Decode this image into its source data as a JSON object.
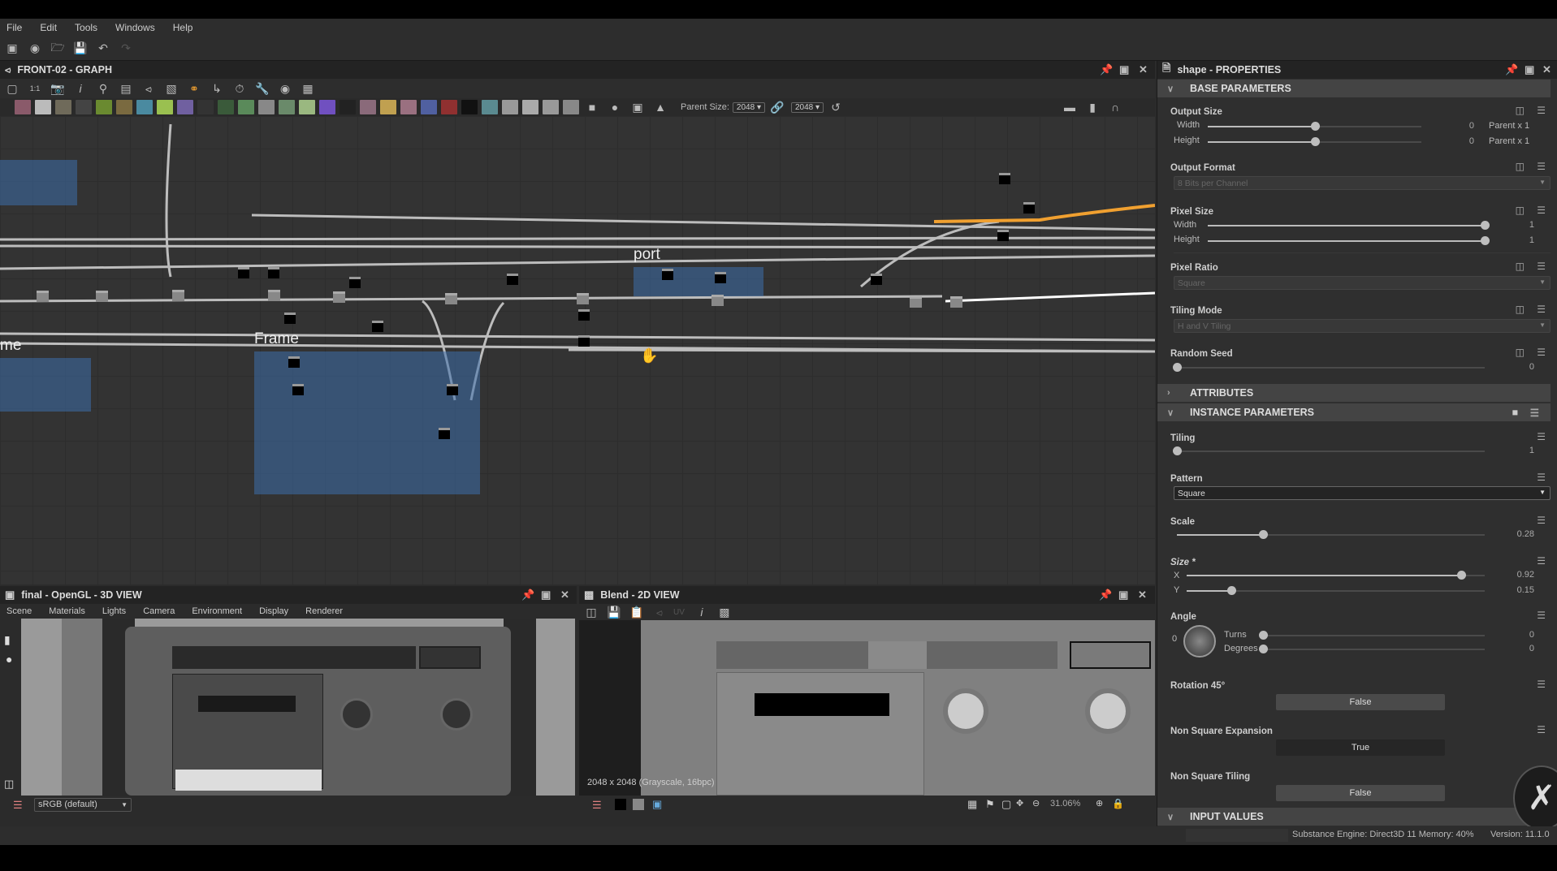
{
  "menu": [
    "File",
    "Edit",
    "Tools",
    "Windows",
    "Help"
  ],
  "main_toolbar": {
    "icons": [
      "new-package-icon",
      "new-graph-icon",
      "open-icon",
      "save-icon",
      "undo-icon",
      "redo-icon"
    ]
  },
  "graph": {
    "title": "FRONT-02 - GRAPH",
    "toolbar_icons": [
      "frame-all-icon",
      "zoom-1-1-icon",
      "screenshot-icon",
      "info-icon",
      "search-icon",
      "align-icon",
      "graph-icon",
      "stack-icon",
      "link-icon",
      "connect-icon",
      "timer-icon",
      "tools-icon",
      "preview-icon",
      "grid-snap-icon"
    ],
    "parent_size_label": "Parent Size:",
    "parent_size_w": "2048",
    "parent_size_h": "2048",
    "frames": [
      {
        "title": "port"
      },
      {
        "title": "Frame"
      },
      {
        "title": "me"
      }
    ]
  },
  "properties": {
    "title": "shape - PROPERTIES",
    "sections": {
      "base": "BASE PARAMETERS",
      "attributes": "ATTRIBUTES",
      "instance": "INSTANCE PARAMETERS",
      "input": "INPUT VALUES"
    },
    "output_size": {
      "label": "Output Size",
      "width_label": "Width",
      "height_label": "Height",
      "width_value": "0",
      "height_value": "0",
      "width_suffix": "Parent x 1",
      "height_suffix": "Parent x 1",
      "width_fraction": 0.5,
      "height_fraction": 0.5
    },
    "output_format": {
      "label": "Output Format",
      "value": "8 Bits per Channel"
    },
    "pixel_size": {
      "label": "Pixel Size",
      "width_label": "Width",
      "height_label": "Height",
      "width_value": "1",
      "height_value": "1",
      "width_fraction": 1.0,
      "height_fraction": 1.0
    },
    "pixel_ratio": {
      "label": "Pixel Ratio",
      "value": "Square"
    },
    "tiling_mode": {
      "label": "Tiling Mode",
      "value": "H and V Tiling"
    },
    "random_seed": {
      "label": "Random Seed",
      "value": "0",
      "fraction": 0.0
    },
    "tiling": {
      "label": "Tiling",
      "value": "1",
      "fraction": 0.0
    },
    "pattern": {
      "label": "Pattern",
      "value": "Square"
    },
    "scale": {
      "label": "Scale",
      "value": "0.28",
      "fraction": 0.28
    },
    "size": {
      "label": "Size *",
      "x_label": "X",
      "y_label": "Y",
      "x_value": "0.92",
      "y_value": "0.15",
      "x_fraction": 0.92,
      "y_fraction": 0.15
    },
    "angle": {
      "label": "Angle",
      "dial_value": "0",
      "turns_label": "Turns",
      "degrees_label": "Degrees",
      "turns_value": "0",
      "degrees_value": "0"
    },
    "rotation45": {
      "label": "Rotation 45°",
      "value": "False"
    },
    "non_square_expansion": {
      "label": "Non Square Expansion",
      "value": "True"
    },
    "non_square_tiling": {
      "label": "Non Square Tiling",
      "value": "False"
    }
  },
  "view3d": {
    "title": "final - OpenGL - 3D VIEW",
    "menu": [
      "Scene",
      "Materials",
      "Lights",
      "Camera",
      "Environment",
      "Display",
      "Renderer"
    ],
    "colorspace": "sRGB (default)"
  },
  "view2d": {
    "title": "Blend - 2D VIEW",
    "uv_label": "UV",
    "image_info": "2048 x 2048 (Grayscale, 16bpc)",
    "zoom": "31.06%"
  },
  "status": {
    "engine": "Substance Engine: Direct3D 11  Memory: 40%",
    "version": "Version: 11.1.0"
  },
  "colors": {
    "accent_orange": "#f0a030",
    "frame_blue": "#3c6eaa",
    "node_red": "#b02020"
  }
}
